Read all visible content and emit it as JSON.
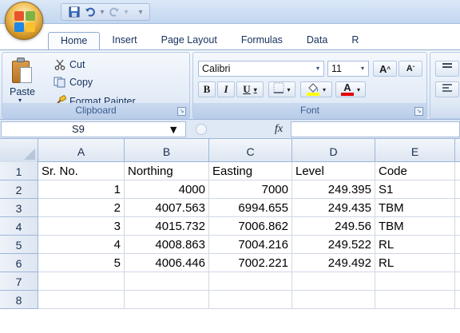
{
  "window": {
    "quick_access_separator": "▾"
  },
  "ribbon_tabs": [
    {
      "label": "Home"
    },
    {
      "label": "Insert"
    },
    {
      "label": "Page Layout"
    },
    {
      "label": "Formulas"
    },
    {
      "label": "Data"
    },
    {
      "label": "R"
    }
  ],
  "clipboard": {
    "paste_label": "Paste",
    "cut_label": "Cut",
    "copy_label": "Copy",
    "format_painter_label": "Format Painter",
    "group_label": "Clipboard"
  },
  "font": {
    "family": "Calibri",
    "size": "11",
    "grow_label": "A",
    "shrink_label": "A",
    "bold_label": "B",
    "italic_label": "I",
    "underline_label": "U",
    "font_color_label": "A",
    "group_label": "Font",
    "highlight_color": "#ffff00",
    "font_color": "#e00000"
  },
  "formula_bar": {
    "name_box": "S9",
    "fx_label": "fx",
    "formula": ""
  },
  "sheet": {
    "columns": [
      "A",
      "B",
      "C",
      "D",
      "E"
    ],
    "rows": [
      {
        "num": "1",
        "cells": [
          "Sr. No.",
          "Northing",
          "Easting",
          "Level",
          "Code"
        ]
      },
      {
        "num": "2",
        "cells": [
          "1",
          "4000",
          "7000",
          "249.395",
          "S1"
        ]
      },
      {
        "num": "3",
        "cells": [
          "2",
          "4007.563",
          "6994.655",
          "249.435",
          "TBM"
        ]
      },
      {
        "num": "4",
        "cells": [
          "3",
          "4015.732",
          "7006.862",
          "249.56",
          "TBM"
        ]
      },
      {
        "num": "5",
        "cells": [
          "4",
          "4008.863",
          "7004.216",
          "249.522",
          "RL"
        ]
      },
      {
        "num": "6",
        "cells": [
          "5",
          "4006.446",
          "7002.221",
          "249.492",
          "RL"
        ]
      },
      {
        "num": "7",
        "cells": [
          "",
          "",
          "",
          "",
          ""
        ]
      },
      {
        "num": "8",
        "cells": [
          "",
          "",
          "",
          "",
          ""
        ]
      }
    ]
  }
}
